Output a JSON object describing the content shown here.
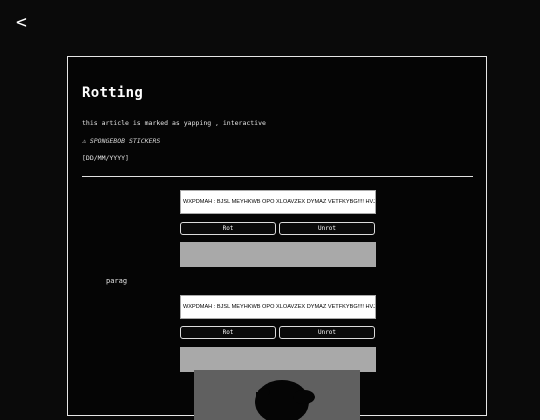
{
  "nav": {
    "back_label": "<"
  },
  "article": {
    "title": "Rotting",
    "subtitle": "this article is marked as yapping , interactive",
    "tag": "⚠ SPONGEBOB STICKERS",
    "date": "[DD/MM/YYYY]"
  },
  "widgets": [
    {
      "code_text": "WXPDMAH : BJSL MEYHKWB OPO XLOAVZEX DYMAZ VETFKYBG!!!! HVJ",
      "rot_label": "Rot",
      "unrot_label": "Unrot"
    },
    {
      "code_text": "WXPDMAH : BJSL MEYHKWB OPO XLOAVZEX DYMAZ VETFKYBG!!!! HVJ",
      "rot_label": "Rot",
      "unrot_label": "Unrot"
    }
  ],
  "paragraph_label": "parag",
  "colors": {
    "background": "#0a0a0a",
    "text": "#ffffff",
    "output_box": "#a9a9a9",
    "code_box": "#ffffff"
  },
  "sticker_image": "spongebob-sticker-silhouette"
}
